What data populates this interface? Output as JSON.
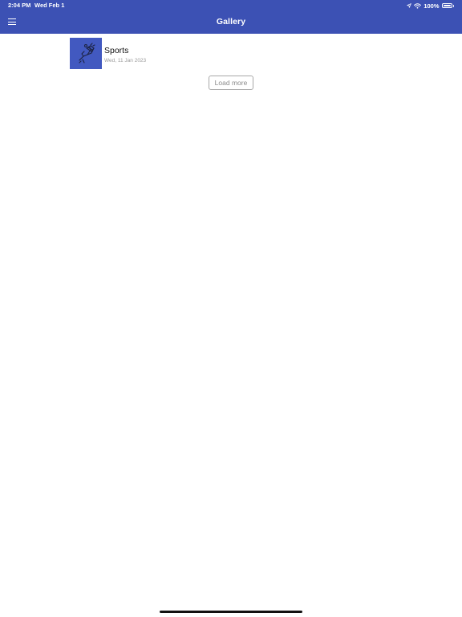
{
  "status_bar": {
    "time": "2:04 PM",
    "date": "Wed Feb 1",
    "battery": "100%"
  },
  "nav": {
    "title": "Gallery",
    "menu_icon": "hamburger-menu-icon"
  },
  "gallery": {
    "items": [
      {
        "title": "Sports",
        "date": "Wed, 11 Jan 2023",
        "icon": "cheerleader-megaphone-icon"
      }
    ],
    "load_more_label": "Load more"
  },
  "colors": {
    "header_bg": "#3c51b4",
    "thumb_bg": "#4259c0"
  }
}
